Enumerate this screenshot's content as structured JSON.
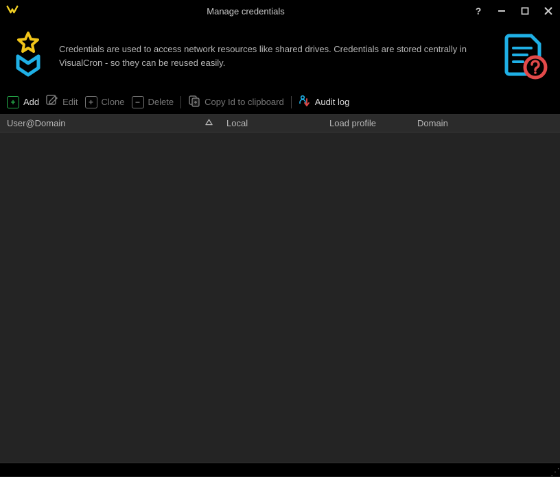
{
  "window": {
    "title": "Manage credentials"
  },
  "info": {
    "text": "Credentials are used to access network resources like shared drives. Credentials are stored centrally in VisualCron - so they can be reused easily."
  },
  "toolbar": {
    "add": "Add",
    "edit": "Edit",
    "clone": "Clone",
    "delete": "Delete",
    "copy_id": "Copy Id to clipboard",
    "audit_log": "Audit log"
  },
  "table": {
    "columns": {
      "user_domain": "User@Domain",
      "local": "Local",
      "load_profile": "Load profile",
      "domain": "Domain"
    },
    "rows": []
  }
}
